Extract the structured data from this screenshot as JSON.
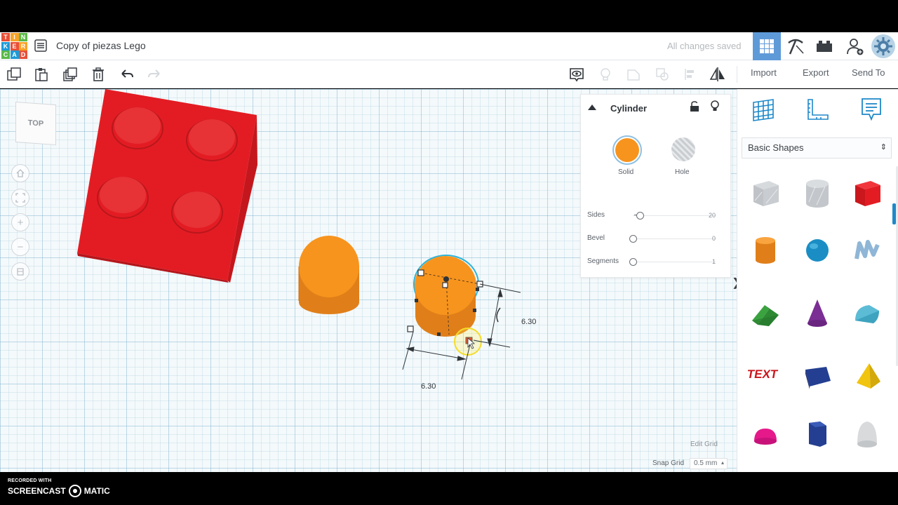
{
  "app": {
    "logo_letters": [
      "T",
      "I",
      "N",
      "K",
      "E",
      "R",
      "C",
      "A",
      "D"
    ],
    "logo_colors": [
      "#e94f37",
      "#f7a325",
      "#5ab947",
      "#1d9bd7",
      "#e94f37",
      "#f7a325",
      "#5ab947",
      "#1d9bd7",
      "#e94f37"
    ],
    "document_title": "Copy of piezas Lego",
    "save_status": "All changes saved"
  },
  "toolbar": {
    "import_label": "Import",
    "export_label": "Export",
    "send_to_label": "Send To"
  },
  "viewcube": {
    "face_label": "TOP"
  },
  "inspector": {
    "title": "Cylinder",
    "solid_label": "Solid",
    "hole_label": "Hole",
    "solid_color": "#f7941d",
    "params": [
      {
        "label": "Sides",
        "value": "20",
        "fraction": 0.1
      },
      {
        "label": "Bevel",
        "value": "0",
        "fraction": 0.0
      },
      {
        "label": "Segments",
        "value": "1",
        "fraction": 0.0
      }
    ]
  },
  "workplane": {
    "dimension_width": "6.30",
    "dimension_height": "6.30",
    "edit_grid_label": "Edit Grid",
    "snap_grid_label": "Snap Grid",
    "snap_grid_value": "0.5 mm",
    "brick_color": "#e11f26",
    "cylinder_color": "#f7941d"
  },
  "shape_panel": {
    "category": "Basic Shapes",
    "shapes": [
      "box-hole",
      "cylinder-hole",
      "box",
      "cylinder",
      "sphere",
      "scribble",
      "roof",
      "cone",
      "round-roof",
      "text",
      "wedge",
      "pyramid",
      "half-sphere",
      "polygon",
      "paraboloid"
    ]
  },
  "watermark": {
    "top": "RECORDED WITH",
    "left": "SCREENCAST",
    "right": "MATIC"
  }
}
